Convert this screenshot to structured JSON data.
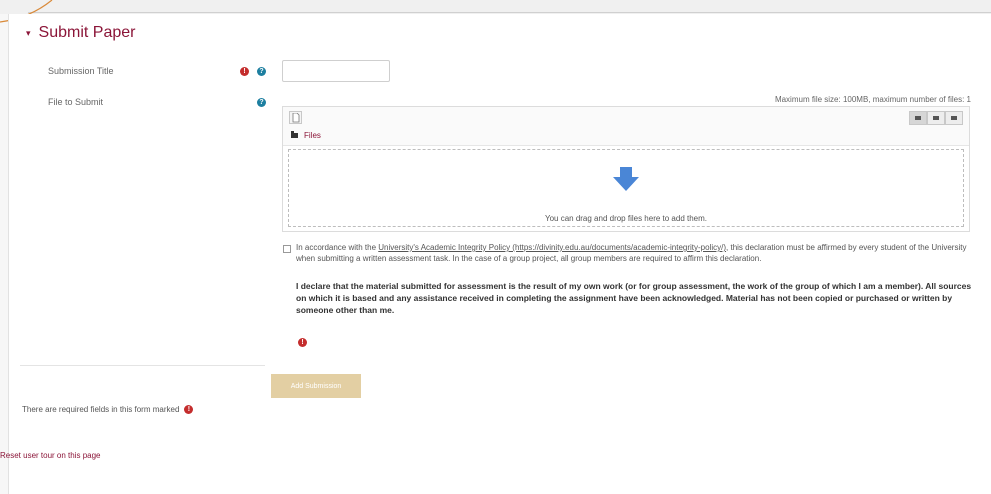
{
  "section": {
    "legend": "Submit Paper",
    "chevron": "▾"
  },
  "fields": {
    "submission_title": {
      "label": "Submission Title",
      "value": ""
    },
    "file_to_submit": {
      "label": "File to Submit"
    }
  },
  "icons": {
    "required": "!",
    "help": "?"
  },
  "filepicker": {
    "max_info": "Maximum file size: 100MB, maximum number of files: 1",
    "path_label": "Files",
    "drop_text": "You can drag and drop files here to add them.",
    "views": [
      "icons-view-icon",
      "list-view-icon",
      "tree-view-icon"
    ]
  },
  "declaration": {
    "intro": "In accordance with the ",
    "link_text": "University's Academic Integrity Policy (https://divinity.edu.au/documents/academic-integrity-policy/)",
    "rest": ", this declaration must be affirmed by every student of the University when submitting a written assessment task. In the case of a group project, all group members are required to affirm this declaration.",
    "bold": "I declare that the material submitted for assessment is the result of my own work (or for group assessment, the work of the group of which I am a member). All sources on which it is based and any assistance received in completing the assignment have been acknowledged. Material has not been copied or purchased or written by someone other than me.",
    "checked": false
  },
  "actions": {
    "submit_label": "Add Submission"
  },
  "footer": {
    "required_note": "There are required fields in this form marked",
    "reset_tour": "Reset user tour on this page"
  },
  "colors": {
    "brand": "#8b1538",
    "required": "#c42d2d",
    "help": "#1d7fa0",
    "submit_disabled": "#e3cfa3",
    "drop_arrow": "#4a86d6"
  }
}
